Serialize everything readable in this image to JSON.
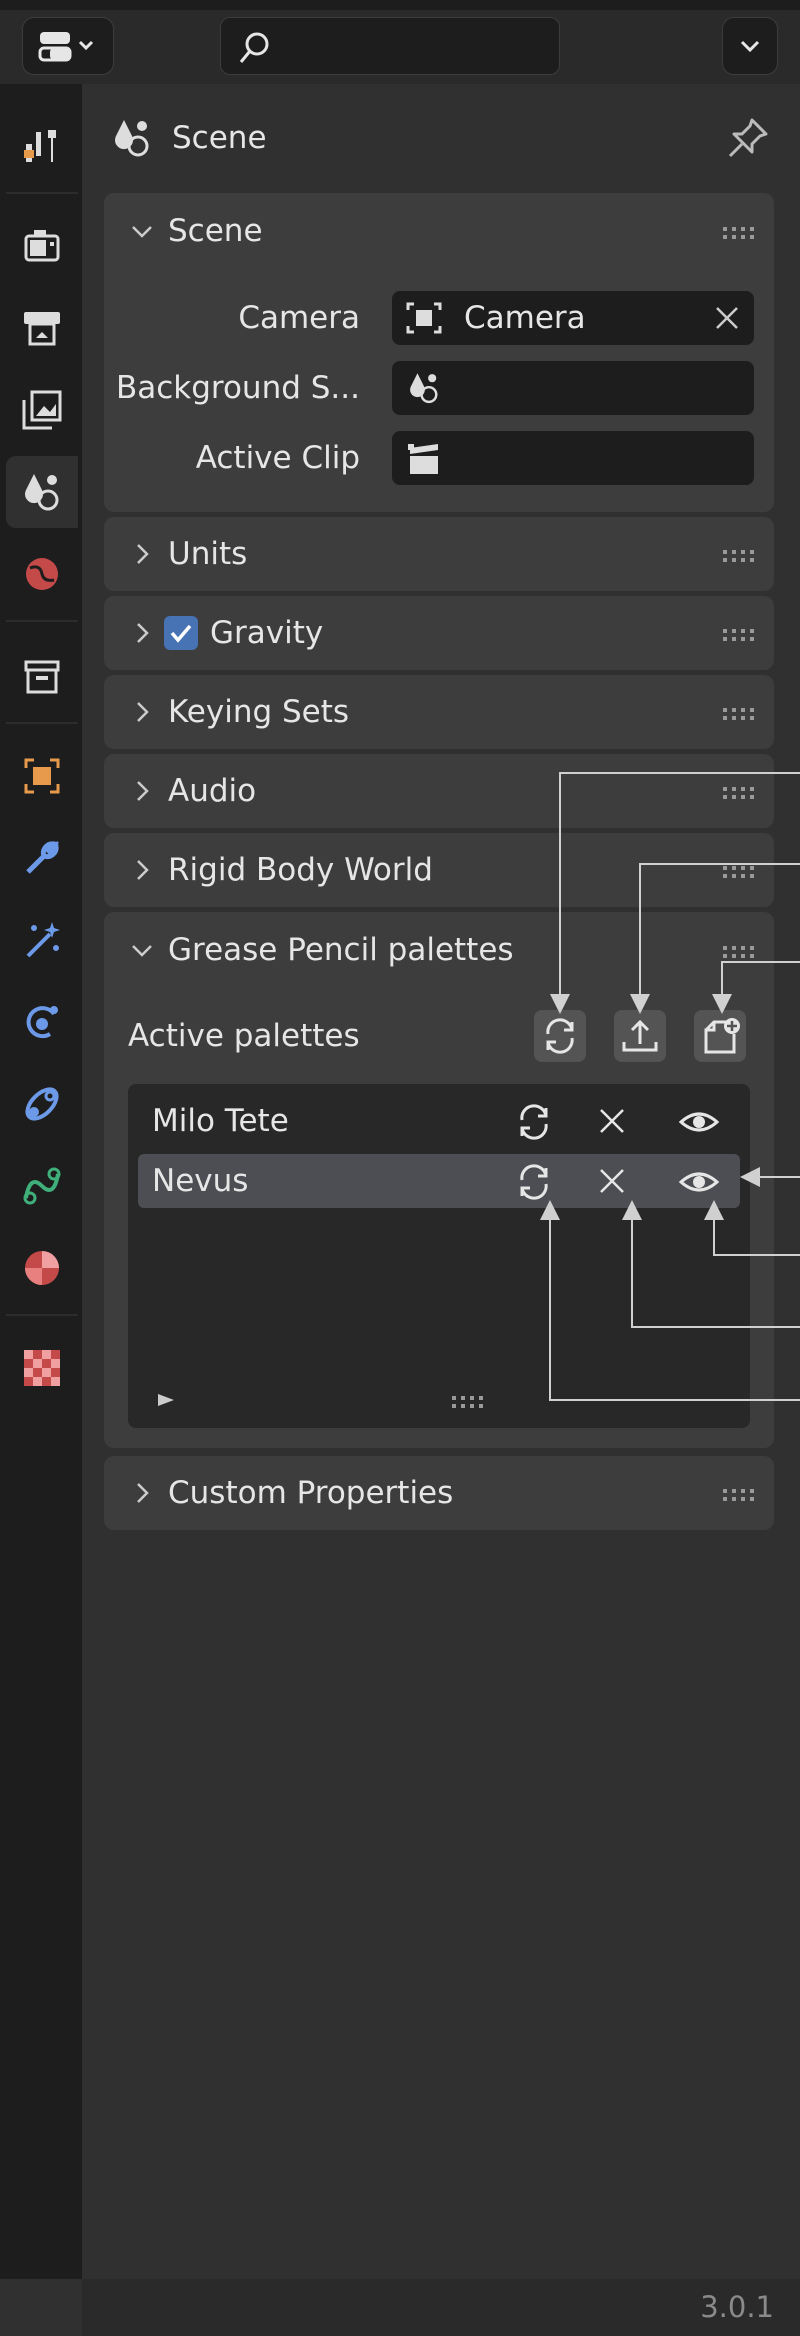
{
  "header": {
    "editor_type_icon": "properties-editor-icon",
    "search_placeholder": ""
  },
  "context": {
    "label": "Scene"
  },
  "panels": {
    "scene": {
      "title": "Scene",
      "camera_label": "Camera",
      "camera_value": "Camera",
      "background_label": "Background S...",
      "active_clip_label": "Active Clip"
    },
    "units": "Units",
    "gravity": "Gravity",
    "keying_sets": "Keying Sets",
    "audio": "Audio",
    "rigid_body": "Rigid Body World",
    "grease_pencil": {
      "title": "Grease Pencil palettes",
      "active_label": "Active palettes",
      "palettes": [
        {
          "name": "Milo Tete",
          "selected": false
        },
        {
          "name": "Nevus",
          "selected": true
        }
      ]
    },
    "custom_properties": "Custom Properties"
  },
  "footer": {
    "version": "3.0.1"
  },
  "colors": {
    "accent": "#4772b3",
    "background": "#303030",
    "panel": "#3d3d3d",
    "sidebar": "#1d1d1d"
  }
}
